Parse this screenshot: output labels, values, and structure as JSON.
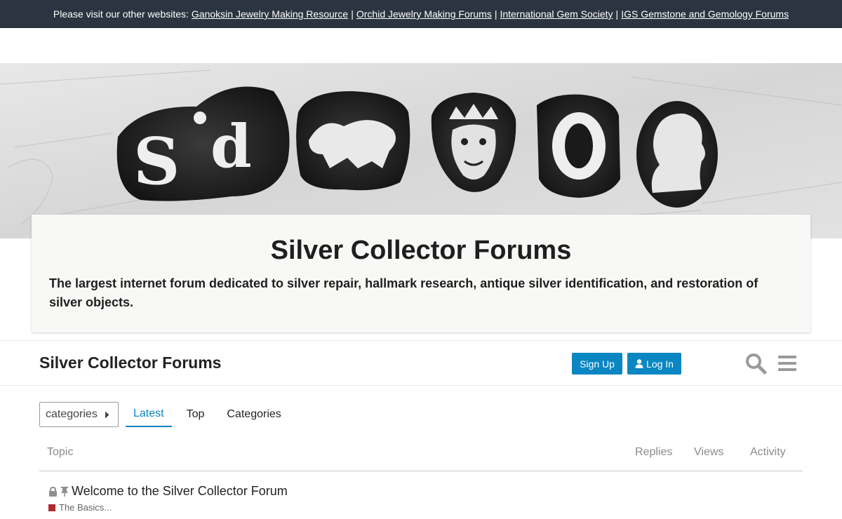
{
  "topbar": {
    "prefix": "Please visit our other websites:",
    "links": [
      "Ganoksin Jewelry Making Resource",
      "Orchid Jewelry Making Forums",
      "International Gem Society",
      "IGS Gemstone and Gemology Forums"
    ],
    "separator": "|"
  },
  "hero": {
    "title": "Silver Collector Forums",
    "description": "The largest internet forum dedicated to silver repair, hallmark research, antique silver identification, and restoration of silver objects.",
    "banner_marks": [
      "Sd",
      "lion",
      "leopard-head",
      "O",
      "sovereign-head"
    ]
  },
  "header": {
    "site_title": "Silver Collector Forums",
    "signup_label": "Sign Up",
    "login_label": "Log In"
  },
  "nav": {
    "categories_dropdown": "categories",
    "tabs": [
      "Latest",
      "Top",
      "Categories"
    ],
    "active_tab": "Latest"
  },
  "table": {
    "columns": {
      "topic": "Topic",
      "replies": "Replies",
      "views": "Views",
      "activity": "Activity"
    },
    "rows": [
      {
        "title": "Welcome to the Silver Collector Forum",
        "category": "The Basics...",
        "category_color": "#b3282e",
        "locked": true,
        "pinned": true
      }
    ]
  },
  "colors": {
    "accent": "#0a86c3",
    "topbar": "#2b3440"
  }
}
